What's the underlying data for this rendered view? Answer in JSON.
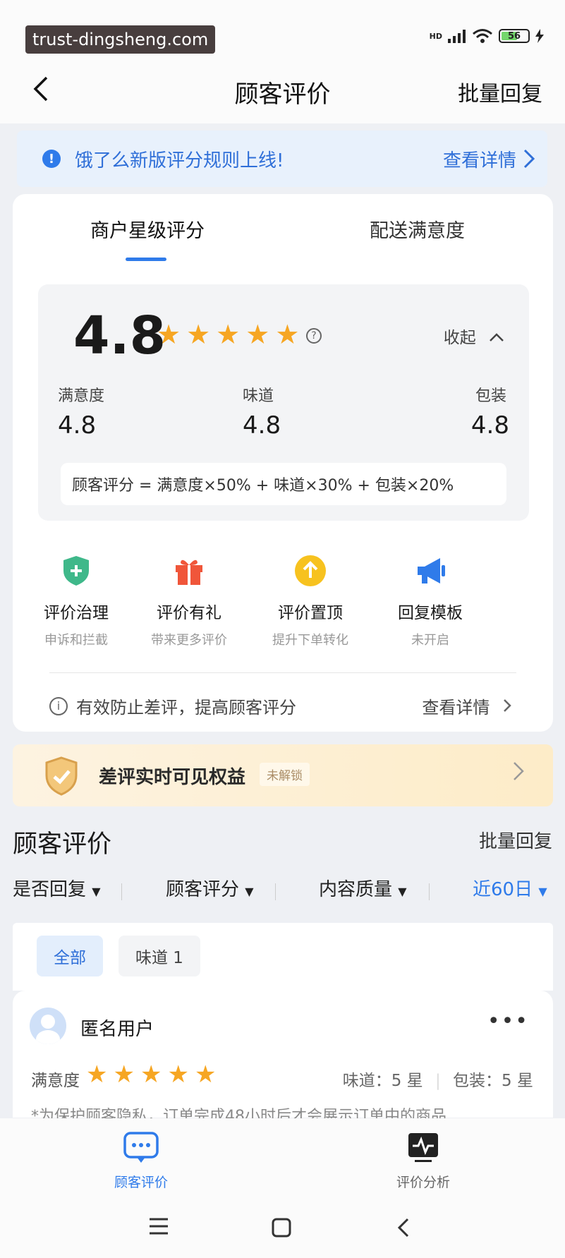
{
  "status_bar": {
    "watermark": "trust-dingsheng.com",
    "network": "HD",
    "battery": "56"
  },
  "header": {
    "title": "顾客评价",
    "right_action": "批量回复"
  },
  "notice": {
    "text": "饿了么新版评分规则上线!",
    "link": "查看详情"
  },
  "rating_tabs": [
    {
      "label": "商户星级评分",
      "active": true
    },
    {
      "label": "配送满意度",
      "active": false
    }
  ],
  "score": {
    "overall": "4.8",
    "stars": 5,
    "collapse_label": "收起",
    "metrics": [
      {
        "label": "满意度",
        "value": "4.8"
      },
      {
        "label": "味道",
        "value": "4.8"
      },
      {
        "label": "包装",
        "value": "4.8"
      }
    ],
    "formula": "顾客评分 = 满意度×50% + 味道×30% + 包装×20%"
  },
  "tools": [
    {
      "title": "评价治理",
      "subtitle": "申诉和拦截",
      "icon": "shield-plus-icon",
      "color": "#3fb88a"
    },
    {
      "title": "评价有礼",
      "subtitle": "带来更多评价",
      "icon": "gift-icon",
      "color": "#f0563a"
    },
    {
      "title": "评价置顶",
      "subtitle": "提升下单转化",
      "icon": "arrow-up-circle-icon",
      "color": "#f7c21f"
    },
    {
      "title": "回复模板",
      "subtitle": "未开启",
      "icon": "megaphone-icon",
      "color": "#2f7bea"
    }
  ],
  "tip": {
    "text": "有效防止差评，提高顾客评分",
    "link": "查看详情"
  },
  "benefit_banner": {
    "title": "差评实时可见权益",
    "badge": "未解锁"
  },
  "reviews_section": {
    "title": "顾客评价",
    "right_action": "批量回复",
    "filters": [
      "是否回复",
      "顾客评分",
      "内容质量",
      "近60日"
    ],
    "chips": [
      "全部",
      "味道 1"
    ]
  },
  "review": {
    "user": "匿名用户",
    "satisfaction_label": "满意度",
    "stars": 5,
    "taste": "味道：5 星",
    "packaging": "包装：5 星",
    "note": "*为保护顾客隐私，订单完成48小时后才会展示订单中的商品"
  },
  "bottom_tabs": [
    {
      "label": "顾客评价",
      "active": true
    },
    {
      "label": "评价分析",
      "active": false
    }
  ],
  "colors": {
    "accent": "#2f7bea",
    "star": "#f6a623"
  }
}
